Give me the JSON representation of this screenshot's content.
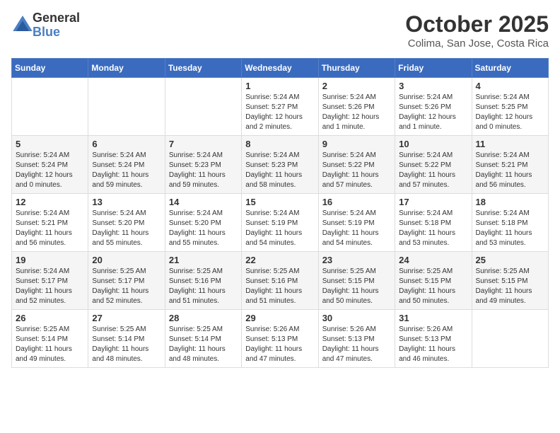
{
  "header": {
    "logo_general": "General",
    "logo_blue": "Blue",
    "month_title": "October 2025",
    "location": "Colima, San Jose, Costa Rica"
  },
  "calendar": {
    "days_of_week": [
      "Sunday",
      "Monday",
      "Tuesday",
      "Wednesday",
      "Thursday",
      "Friday",
      "Saturday"
    ],
    "weeks": [
      [
        {
          "day": "",
          "info": ""
        },
        {
          "day": "",
          "info": ""
        },
        {
          "day": "",
          "info": ""
        },
        {
          "day": "1",
          "info": "Sunrise: 5:24 AM\nSunset: 5:27 PM\nDaylight: 12 hours\nand 2 minutes."
        },
        {
          "day": "2",
          "info": "Sunrise: 5:24 AM\nSunset: 5:26 PM\nDaylight: 12 hours\nand 1 minute."
        },
        {
          "day": "3",
          "info": "Sunrise: 5:24 AM\nSunset: 5:26 PM\nDaylight: 12 hours\nand 1 minute."
        },
        {
          "day": "4",
          "info": "Sunrise: 5:24 AM\nSunset: 5:25 PM\nDaylight: 12 hours\nand 0 minutes."
        }
      ],
      [
        {
          "day": "5",
          "info": "Sunrise: 5:24 AM\nSunset: 5:24 PM\nDaylight: 12 hours\nand 0 minutes."
        },
        {
          "day": "6",
          "info": "Sunrise: 5:24 AM\nSunset: 5:24 PM\nDaylight: 11 hours\nand 59 minutes."
        },
        {
          "day": "7",
          "info": "Sunrise: 5:24 AM\nSunset: 5:23 PM\nDaylight: 11 hours\nand 59 minutes."
        },
        {
          "day": "8",
          "info": "Sunrise: 5:24 AM\nSunset: 5:23 PM\nDaylight: 11 hours\nand 58 minutes."
        },
        {
          "day": "9",
          "info": "Sunrise: 5:24 AM\nSunset: 5:22 PM\nDaylight: 11 hours\nand 57 minutes."
        },
        {
          "day": "10",
          "info": "Sunrise: 5:24 AM\nSunset: 5:22 PM\nDaylight: 11 hours\nand 57 minutes."
        },
        {
          "day": "11",
          "info": "Sunrise: 5:24 AM\nSunset: 5:21 PM\nDaylight: 11 hours\nand 56 minutes."
        }
      ],
      [
        {
          "day": "12",
          "info": "Sunrise: 5:24 AM\nSunset: 5:21 PM\nDaylight: 11 hours\nand 56 minutes."
        },
        {
          "day": "13",
          "info": "Sunrise: 5:24 AM\nSunset: 5:20 PM\nDaylight: 11 hours\nand 55 minutes."
        },
        {
          "day": "14",
          "info": "Sunrise: 5:24 AM\nSunset: 5:20 PM\nDaylight: 11 hours\nand 55 minutes."
        },
        {
          "day": "15",
          "info": "Sunrise: 5:24 AM\nSunset: 5:19 PM\nDaylight: 11 hours\nand 54 minutes."
        },
        {
          "day": "16",
          "info": "Sunrise: 5:24 AM\nSunset: 5:19 PM\nDaylight: 11 hours\nand 54 minutes."
        },
        {
          "day": "17",
          "info": "Sunrise: 5:24 AM\nSunset: 5:18 PM\nDaylight: 11 hours\nand 53 minutes."
        },
        {
          "day": "18",
          "info": "Sunrise: 5:24 AM\nSunset: 5:18 PM\nDaylight: 11 hours\nand 53 minutes."
        }
      ],
      [
        {
          "day": "19",
          "info": "Sunrise: 5:24 AM\nSunset: 5:17 PM\nDaylight: 11 hours\nand 52 minutes."
        },
        {
          "day": "20",
          "info": "Sunrise: 5:25 AM\nSunset: 5:17 PM\nDaylight: 11 hours\nand 52 minutes."
        },
        {
          "day": "21",
          "info": "Sunrise: 5:25 AM\nSunset: 5:16 PM\nDaylight: 11 hours\nand 51 minutes."
        },
        {
          "day": "22",
          "info": "Sunrise: 5:25 AM\nSunset: 5:16 PM\nDaylight: 11 hours\nand 51 minutes."
        },
        {
          "day": "23",
          "info": "Sunrise: 5:25 AM\nSunset: 5:15 PM\nDaylight: 11 hours\nand 50 minutes."
        },
        {
          "day": "24",
          "info": "Sunrise: 5:25 AM\nSunset: 5:15 PM\nDaylight: 11 hours\nand 50 minutes."
        },
        {
          "day": "25",
          "info": "Sunrise: 5:25 AM\nSunset: 5:15 PM\nDaylight: 11 hours\nand 49 minutes."
        }
      ],
      [
        {
          "day": "26",
          "info": "Sunrise: 5:25 AM\nSunset: 5:14 PM\nDaylight: 11 hours\nand 49 minutes."
        },
        {
          "day": "27",
          "info": "Sunrise: 5:25 AM\nSunset: 5:14 PM\nDaylight: 11 hours\nand 48 minutes."
        },
        {
          "day": "28",
          "info": "Sunrise: 5:25 AM\nSunset: 5:14 PM\nDaylight: 11 hours\nand 48 minutes."
        },
        {
          "day": "29",
          "info": "Sunrise: 5:26 AM\nSunset: 5:13 PM\nDaylight: 11 hours\nand 47 minutes."
        },
        {
          "day": "30",
          "info": "Sunrise: 5:26 AM\nSunset: 5:13 PM\nDaylight: 11 hours\nand 47 minutes."
        },
        {
          "day": "31",
          "info": "Sunrise: 5:26 AM\nSunset: 5:13 PM\nDaylight: 11 hours\nand 46 minutes."
        },
        {
          "day": "",
          "info": ""
        }
      ]
    ]
  }
}
